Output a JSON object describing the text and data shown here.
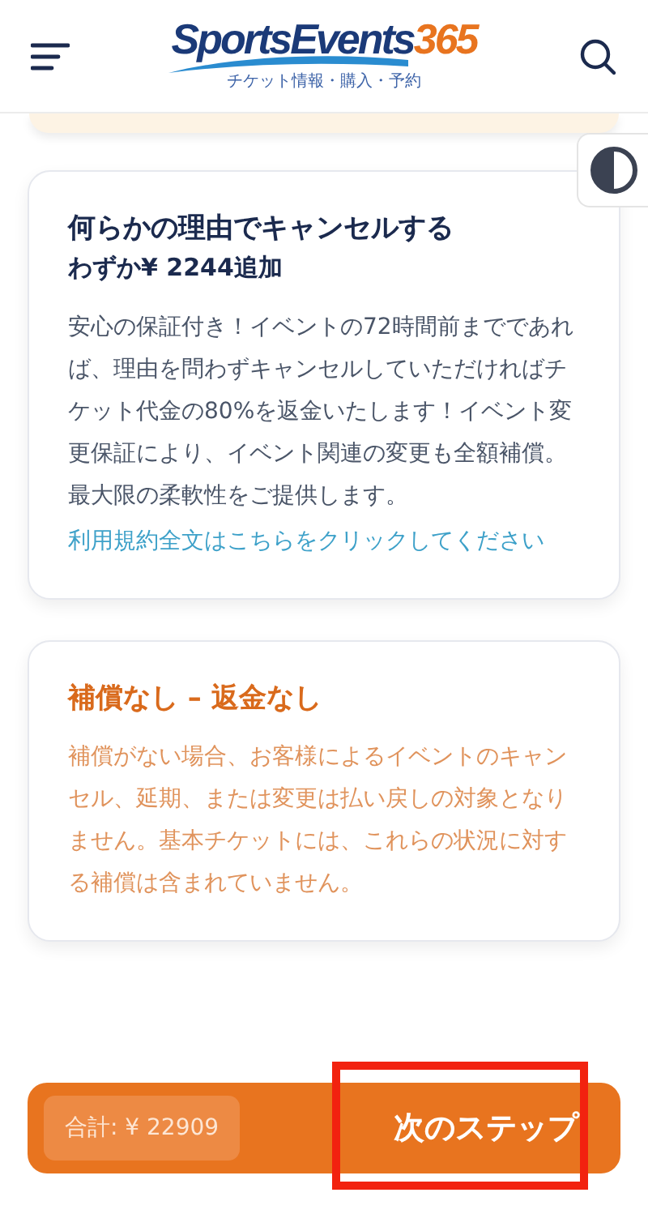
{
  "header": {
    "logo": {
      "name": "SportsEvents",
      "accent": "365",
      "tagline": "チケット情報・購入・予約"
    }
  },
  "options": [
    {
      "kind": "protected",
      "title": "何らかの理由でキャンセルする",
      "price": "わずか¥ 2244追加",
      "description": "安心の保証付き！イベントの72時間前までであれば、理由を問わずキャンセルしていただければチケット代金の80%を返金いたします！イベント変更保証により、イベント関連の変更も全額補償。最大限の柔軟性をご提供します。",
      "link": "利用規約全文はこちらをクリックしてください"
    },
    {
      "kind": "unprotected",
      "title": "補償なし – 返金なし",
      "description": "補償がない場合、お客様によるイベントのキャンセル、延期、または変更は払い戻しの対象となりません。基本チケットには、これらの状況に対する補償は含まれていません。"
    }
  ],
  "footer": {
    "total": "合計: ¥ 22909",
    "next_button": {
      "label": "次のステップ",
      "highlighted": true
    }
  }
}
